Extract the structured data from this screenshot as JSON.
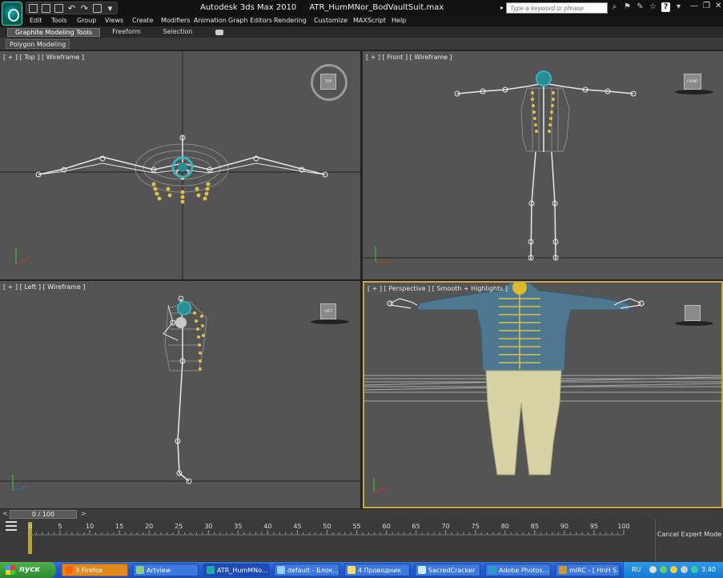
{
  "window": {
    "app_name": "Autodesk 3ds Max  2010",
    "file_name": "ATR_HumMNor_BodVaultSuit.max",
    "search_placeholder": "Type a keyword or phrase",
    "controls": [
      "—",
      "❐",
      "✕"
    ]
  },
  "menu": [
    "Edit",
    "Tools",
    "Group",
    "Views",
    "Create",
    "Modifiers",
    "Animation",
    "Graph Editors",
    "Rendering",
    "Customize",
    "MAXScript",
    "Help"
  ],
  "ribbon": {
    "tabs": [
      "Graphite Modeling Tools",
      "Freeform",
      "Selection"
    ],
    "panel": "Polygon Modeling"
  },
  "viewports": {
    "top": {
      "label": "[ + ] [ Top ] [ Wireframe ]",
      "cube": "TOP"
    },
    "front": {
      "label": "[ + ] [ Front ] [ Wireframe ]",
      "cube": "FRONT"
    },
    "left": {
      "label": "[ + ] [ Left ] [ Wireframe ]",
      "cube": "LEFT"
    },
    "perspective": {
      "label": "[ + ] [ Perspective ] [ Smooth + Highlights ]"
    }
  },
  "timeline": {
    "frame": "0 / 100",
    "ticks": [
      "0",
      "5",
      "10",
      "15",
      "20",
      "25",
      "30",
      "35",
      "40",
      "45",
      "50",
      "55",
      "60",
      "65",
      "70",
      "75",
      "80",
      "85",
      "90",
      "95",
      "100"
    ],
    "expert_button": "Cancel Expert Mode"
  },
  "taskbar": {
    "start": "пуск",
    "tasks": [
      "3 Firefox",
      "Artview",
      "ATR_HumMNo...",
      "default - Блок...",
      "4 Проводник",
      "SacredCracker",
      "Adobe Photos...",
      "mIRC - [ HnH S..."
    ],
    "lang": "RU",
    "clock": "3:40"
  },
  "colors": {
    "viewport_bg": "#545454",
    "active_border": "#c9a84a",
    "bone": "#e8e8e8",
    "joint": "#d9c24a",
    "jacket": "#4e7890",
    "pants": "#d8d3a4"
  }
}
